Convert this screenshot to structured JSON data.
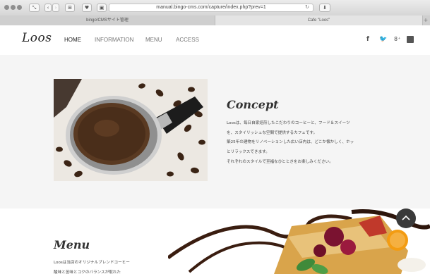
{
  "browser": {
    "address": "manual.bingo-cms.com/capture/index.php?prev=1",
    "tabs": [
      "bingo!CMSサイト管理",
      "Cafe \"Loos\""
    ]
  },
  "header": {
    "logo": "Loos",
    "nav": [
      "HOME",
      "INFORMATION",
      "MENU",
      "ACCESS"
    ],
    "active_nav": "HOME",
    "social_icons": [
      "facebook-icon",
      "twitter-icon",
      "google-plus-icon",
      "blog-icon"
    ]
  },
  "concept": {
    "title": "Concept",
    "lines": [
      "Loosは、毎日自家焙煎したこだわりのコーヒーと、フード＆スイーツ",
      "を、スタイリッシュな空間で提供するカフェです。",
      "築25年の建物をリノベーションした広い店内は、どこか懐かしく、ホッ",
      "とリラックスできます。",
      "それぞれのスタイルで至福なひとときをお楽しみください。"
    ]
  },
  "menu": {
    "title": "Menu",
    "lines": [
      "Loosは当店のオリジナルブレンドコーヒー",
      "酸味と苦味とコクのバランスが取れた"
    ]
  },
  "colors": {
    "concept_background": "#f5f5f5",
    "text": "#444444",
    "back_to_top": "#3a3a3a"
  }
}
